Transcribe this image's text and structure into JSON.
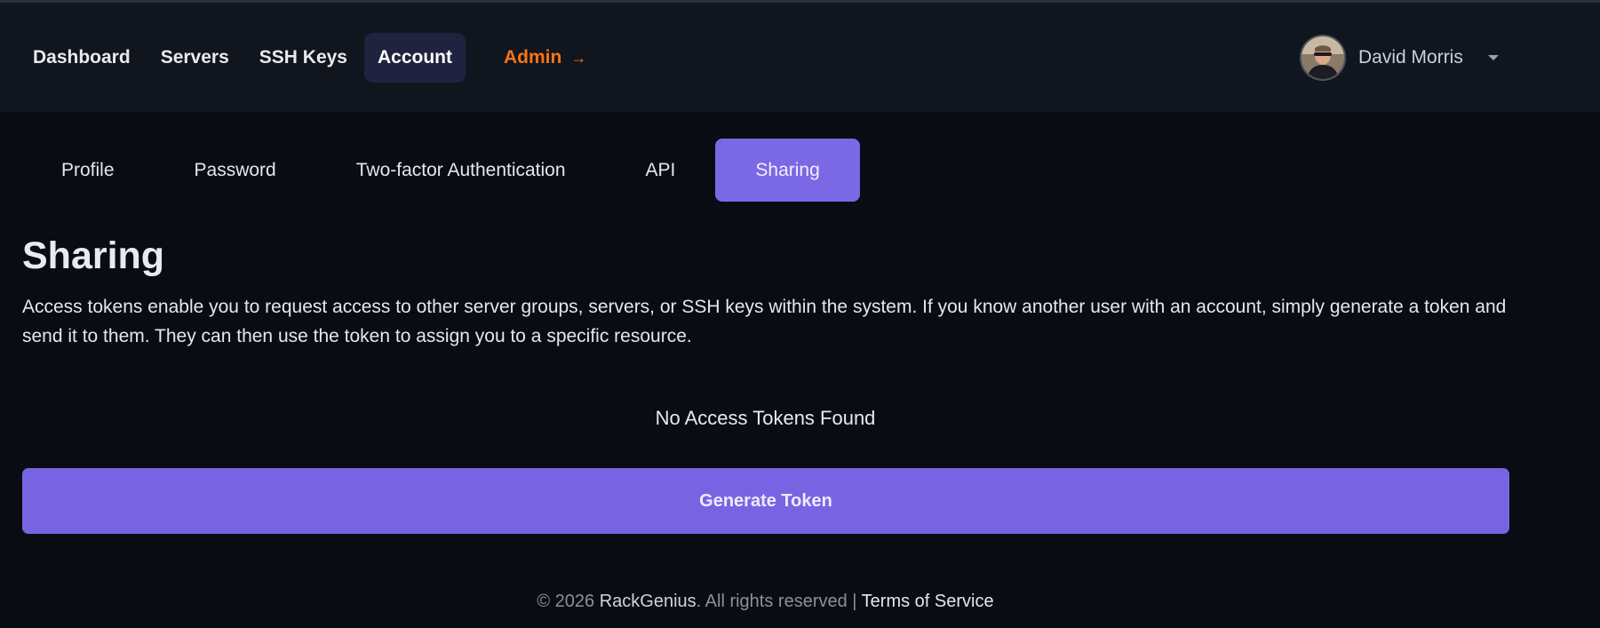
{
  "nav": {
    "links": [
      {
        "label": "Dashboard"
      },
      {
        "label": "Servers"
      },
      {
        "label": "SSH Keys"
      },
      {
        "label": "Account",
        "active": true
      }
    ],
    "admin_label": "Admin",
    "admin_arrow": "→"
  },
  "user": {
    "name": "David Morris",
    "avatar_icon": "user-avatar-photo"
  },
  "tabs": [
    {
      "label": "Profile"
    },
    {
      "label": "Password"
    },
    {
      "label": "Two-factor Authentication"
    },
    {
      "label": "API"
    },
    {
      "label": "Sharing",
      "active": true
    }
  ],
  "section": {
    "title": "Sharing",
    "description": "Access tokens enable you to request access to other server groups, servers, or SSH keys within the system. If you know another user with an account, simply generate a token and send it to them. They can then use the token to assign you to a specific resource.",
    "empty_message": "No Access Tokens Found",
    "button_label": "Generate Token"
  },
  "footer": {
    "copyright": "© 2026 ",
    "brand": "RackGenius",
    "rights": ". All rights reserved | ",
    "terms": "Terms of Service"
  },
  "colors": {
    "accent": "#7b68e5",
    "admin": "#f97316",
    "background": "#090c12",
    "navbar": "#11151d"
  }
}
